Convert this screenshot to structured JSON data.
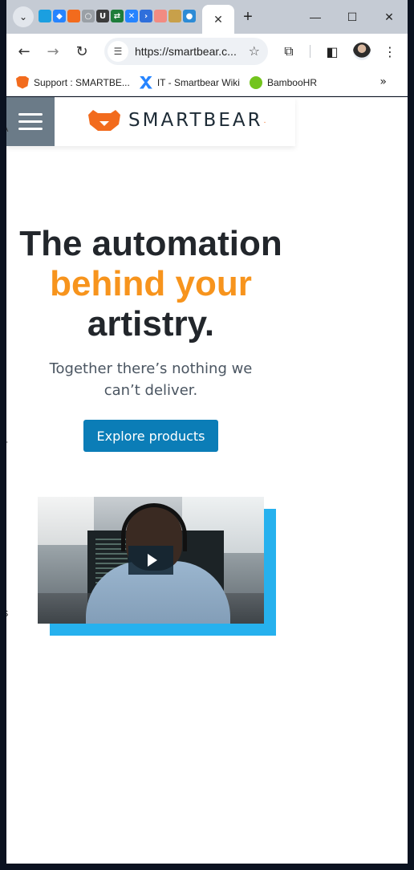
{
  "browser": {
    "tab_search_icon": "chevron-down-icon",
    "favicons": [
      {
        "name": "salesforce-favicon",
        "glyph": "",
        "color": "#1b9fe0"
      },
      {
        "name": "jira-favicon",
        "glyph": "◆",
        "color": "#2684ff"
      },
      {
        "name": "smartbear-favicon",
        "glyph": "",
        "color": "#f26b1d"
      },
      {
        "name": "loading-favicon",
        "glyph": "○",
        "color": "#9aa0a6"
      },
      {
        "name": "u-favicon",
        "glyph": "U",
        "color": "#3c3c3c"
      },
      {
        "name": "sync-favicon",
        "glyph": "⇄",
        "color": "#1e7d3a"
      },
      {
        "name": "confluence-favicon",
        "glyph": "✕",
        "color": "#2684ff"
      },
      {
        "name": "arrow-favicon",
        "glyph": "›",
        "color": "#2f6fdb"
      },
      {
        "name": "gradient-favicon",
        "glyph": "",
        "color": "#f28b82"
      },
      {
        "name": "lock-favicon",
        "glyph": "",
        "color": "#c8a04a"
      },
      {
        "name": "circle-favicon",
        "glyph": "●",
        "color": "#2c8bd6"
      }
    ],
    "active_tab_close": "✕",
    "new_tab": "+",
    "window": {
      "minimize": "—",
      "maximize": "☐",
      "close": "✕"
    },
    "url": "https://smartbear.c...",
    "bookmarks": [
      {
        "label": "Support : SMARTBE...",
        "icon_color": "#f26b1d"
      },
      {
        "label": "IT - Smartbear Wiki",
        "icon_color": "#2684ff"
      },
      {
        "label": "BambooHR",
        "icon_color": "#73c41d"
      }
    ],
    "bookmarks_more": "»"
  },
  "header": {
    "logo_text": "SMARTBEAR",
    "logo_color": "#f26b1d",
    "menu_color": "#6b7b88"
  },
  "hero": {
    "title_line1": "The automation",
    "title_accent": "behind your",
    "title_line3": "artistry.",
    "accent_color": "#f7941d",
    "subtitle": "Together there’s nothing we can’t deliver.",
    "cta_label": "Explore products",
    "cta_color": "#0b7db7"
  },
  "video": {
    "shadow_color": "#26b1ee",
    "play_icon": "play-icon"
  },
  "edge_text": {
    "a": "A",
    "t": "T",
    "s": "S"
  }
}
